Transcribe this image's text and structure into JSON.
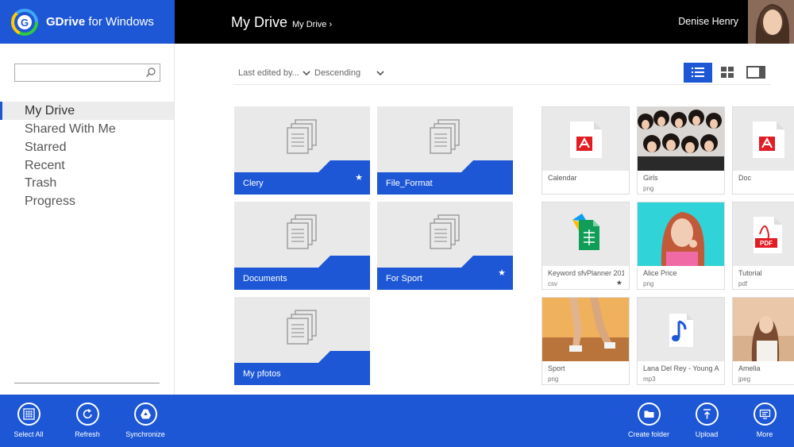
{
  "header": {
    "app_name_bold": "GDrive",
    "app_name_rest": " for Windows",
    "page_title": "My Drive",
    "breadcrumb": "My Drive",
    "user_name": "Denise Henry"
  },
  "sidebar": {
    "search_placeholder": "",
    "items": [
      {
        "label": "My Drive",
        "active": true
      },
      {
        "label": "Shared With Me"
      },
      {
        "label": "Starred"
      },
      {
        "label": "Recent"
      },
      {
        "label": "Trash"
      },
      {
        "label": "Progress"
      }
    ]
  },
  "toolbar": {
    "sort_field": "Last edited by...",
    "sort_order": "Descending"
  },
  "folders": [
    {
      "name": "Clery",
      "starred": true
    },
    {
      "name": "File_Format",
      "starred": false
    },
    {
      "name": "Documents",
      "starred": false
    },
    {
      "name": "For Sport",
      "starred": true
    },
    {
      "name": "My pfotos",
      "starred": false
    }
  ],
  "files": [
    {
      "name": "Calendar",
      "type": "",
      "icon": "acrobat-icon"
    },
    {
      "name": "Girls",
      "type": "png",
      "icon": "photo-thumbnail"
    },
    {
      "name": "Doc",
      "type": "",
      "icon": "acrobat-icon"
    },
    {
      "name": "Keyword sfvPlanner 201...",
      "type": "csv",
      "icon": "sheets-icon",
      "starred": true
    },
    {
      "name": "Alice Price",
      "type": "png",
      "icon": "photo-thumbnail"
    },
    {
      "name": "Tutorial",
      "type": "pdf",
      "icon": "pdf-icon"
    },
    {
      "name": "Sport",
      "type": "png",
      "icon": "photo-thumbnail"
    },
    {
      "name": "Lana Del Rey - Young A...",
      "type": "mp3",
      "icon": "music-note-icon"
    },
    {
      "name": "Amelia",
      "type": "jpeg",
      "icon": "photo-thumbnail"
    }
  ],
  "appbar": {
    "select_all": "Select All",
    "refresh": "Refresh",
    "synchronize": "Synchronize",
    "create_folder": "Create folder",
    "upload": "Upload",
    "more": "More"
  },
  "colors": {
    "accent": "#1d57d5",
    "header_dark": "#000000",
    "tile_bg": "#e9e9e9"
  }
}
